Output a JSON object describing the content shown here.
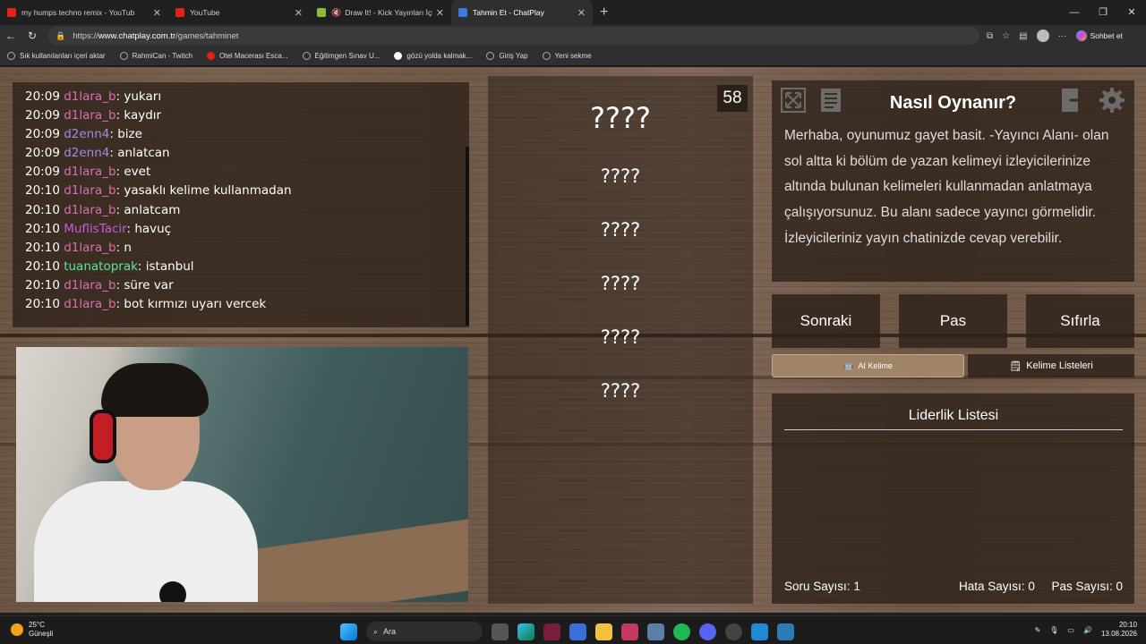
{
  "browser": {
    "tabs": [
      {
        "title": "my humps techno remix - YouTub",
        "favicon_color": "#e62117"
      },
      {
        "title": "YouTube",
        "favicon_color": "#e62117"
      },
      {
        "title": "Draw It! - Kick Yayınları İçin Ç",
        "favicon_color": "#8bbd3b"
      },
      {
        "title": "Tahmin Et - ChatPlay",
        "favicon_color": "#3a7be0"
      }
    ],
    "url_prefix": "https://",
    "url_host": "www.chatplay.com.tr",
    "url_path": "/games/tahminet",
    "copilot_label": "Sohbet et",
    "bookmarks": [
      "Sık kullanılanları içeri aktar",
      "RahmiCan - Twitch",
      "Otel Macerası Esca...",
      "Eğitimgen Sınav U...",
      "gözü yolda kalmak...",
      "Giriş Yap",
      "Yeni sekme"
    ]
  },
  "chat": {
    "messages": [
      {
        "time": "20:09",
        "user": "d1lara_b",
        "color": "#d86fb0",
        "text": "yukarı"
      },
      {
        "time": "20:09",
        "user": "d1lara_b",
        "color": "#d86fb0",
        "text": "kaydır"
      },
      {
        "time": "20:09",
        "user": "d2enn4",
        "color": "#a28ae8",
        "text": "bize"
      },
      {
        "time": "20:09",
        "user": "d2enn4",
        "color": "#a28ae8",
        "text": "anlatcan"
      },
      {
        "time": "20:09",
        "user": "d1lara_b",
        "color": "#d86fb0",
        "text": "evet"
      },
      {
        "time": "20:10",
        "user": "d1lara_b",
        "color": "#d86fb0",
        "text": "yasaklı kelime kullanmadan"
      },
      {
        "time": "20:10",
        "user": "d1lara_b",
        "color": "#d86fb0",
        "text": "anlatcam"
      },
      {
        "time": "20:10",
        "user": "MuflisTacir",
        "color": "#c85ae0",
        "text": "havuç"
      },
      {
        "time": "20:10",
        "user": "d1lara_b",
        "color": "#d86fb0",
        "text": "n"
      },
      {
        "time": "20:10",
        "user": "tuanatoprak",
        "color": "#5fe39b",
        "text": "istanbul"
      },
      {
        "time": "20:10",
        "user": "d1lara_b",
        "color": "#d86fb0",
        "text": "süre var"
      },
      {
        "time": "20:10",
        "user": "d1lara_b",
        "color": "#d86fb0",
        "text": "bot kırmızı uyarı vercek"
      }
    ]
  },
  "game": {
    "timer": "58",
    "main_word": "????",
    "hints": [
      "????",
      "????",
      "????",
      "????",
      "????"
    ]
  },
  "howto": {
    "title": "Nasıl Oynanır?",
    "text": "Merhaba, oyunumuz gayet basit. -Yayıncı Alanı- olan sol altta ki bölüm de yazan kelimeyi izleyicilerinize altında bulunan kelimeleri kullanmadan anlatmaya çalışıyorsunuz. Bu alanı sadece yayıncı görmelidir. İzleyicileriniz yayın chatinizde cevap verebilir."
  },
  "actions": {
    "next": "Sonraki",
    "pass": "Pas",
    "reset": "Sıfırla"
  },
  "modes": {
    "ai": "AI Kelime",
    "lists": "Kelime Listeleri"
  },
  "leaderboard": {
    "title": "Liderlik Listesi",
    "question_label": "Soru Sayısı:",
    "question_value": "1",
    "error_label": "Hata Sayısı:",
    "error_value": "0",
    "pass_label": "Pas Sayısı:",
    "pass_value": "0"
  },
  "taskbar": {
    "temperature": "25°C",
    "weather": "Güneşli",
    "search_placeholder": "Ara",
    "time": "20:10",
    "date": "13.08.2026"
  }
}
